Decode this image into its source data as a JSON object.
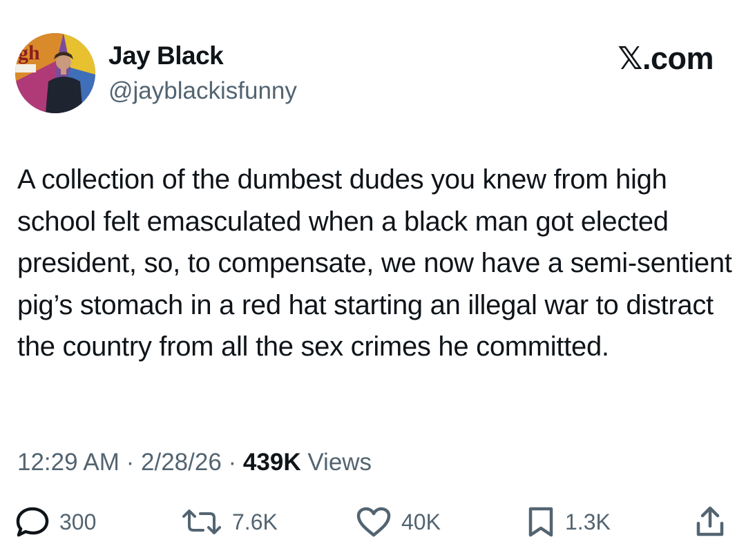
{
  "author": {
    "name": "Jay Black",
    "handle": "@jayblackisfunny"
  },
  "site": {
    "label": "𝕏.com"
  },
  "tweet": {
    "text": "A collection of the dumbest dudes you knew from high school felt emasculated when a black man got elected president, so, to compensate, we now have a semi-sentient pig’s stomach in a red hat starting an illegal war to distract the country from all the sex crimes he committed."
  },
  "meta": {
    "time": "12:29 AM",
    "date": "2/28/26",
    "views_count": "439K",
    "views_label": "Views",
    "separator": "·"
  },
  "actions": {
    "replies": "300",
    "reposts": "7.6K",
    "likes": "40K",
    "bookmarks": "1.3K"
  },
  "icons": {
    "reply": "reply-bubble-icon",
    "repost": "repost-arrows-icon",
    "like": "heart-icon",
    "bookmark": "bookmark-icon",
    "share": "share-upload-icon"
  },
  "colors": {
    "text": "#0f1419",
    "secondary": "#536471"
  }
}
